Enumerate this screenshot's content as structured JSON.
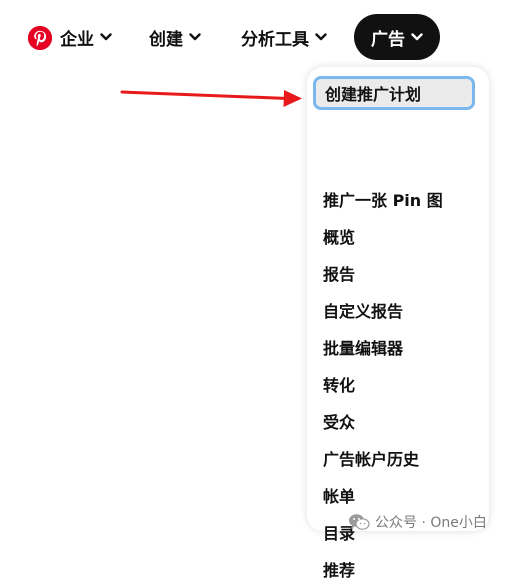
{
  "nav": {
    "brand_icon": "pinterest-logo-icon",
    "brand_color": "#e60023",
    "items": [
      {
        "label": "企业",
        "icon": "chevron-down-icon"
      },
      {
        "label": "创建",
        "icon": "chevron-down-icon"
      },
      {
        "label": "分析工具",
        "icon": "chevron-down-icon"
      },
      {
        "label": "广告",
        "icon": "chevron-down-icon",
        "active": true
      }
    ]
  },
  "ads_menu": {
    "items": [
      {
        "label": "创建推广计划",
        "selected": true
      },
      {
        "label": "推广一张 Pin 图"
      },
      {
        "label": "概览"
      },
      {
        "label": "报告"
      },
      {
        "label": "自定义报告"
      },
      {
        "label": "批量编辑器"
      },
      {
        "label": "转化"
      },
      {
        "label": "受众"
      },
      {
        "label": "广告帐户历史"
      },
      {
        "label": "帐单"
      },
      {
        "label": "目录"
      },
      {
        "label": "推荐"
      }
    ],
    "highlight_border_color": "#7ab8ee",
    "highlight_background": "#ebebeb"
  },
  "annotation": {
    "icon": "red-arrow-icon",
    "color": "#e8191a"
  },
  "watermark": {
    "icon": "wechat-icon",
    "text": "公众号 · One小白"
  }
}
